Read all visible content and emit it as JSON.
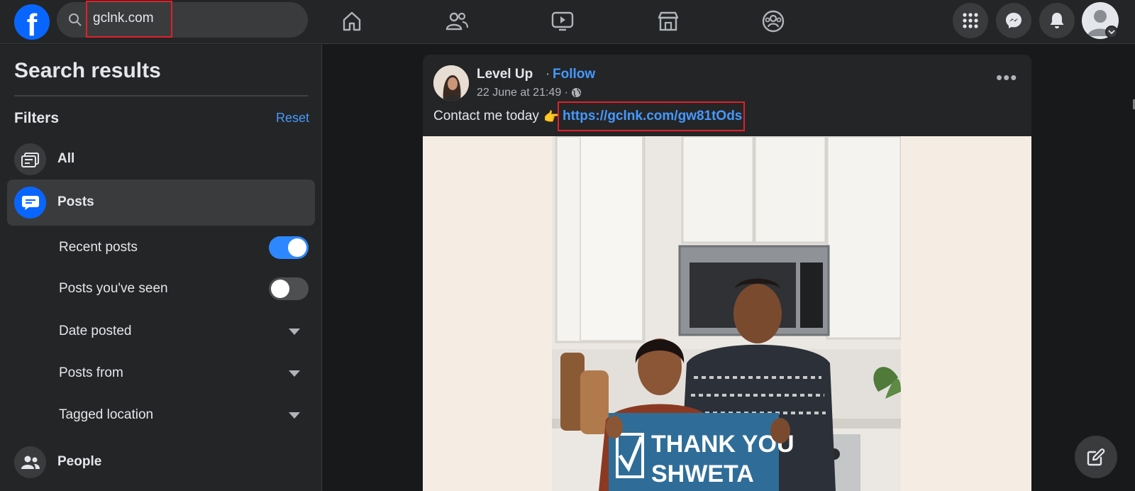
{
  "search": {
    "value": "gclnk.com"
  },
  "top_nav": {
    "items": [
      "home-icon",
      "friends-icon",
      "watch-icon",
      "marketplace-icon",
      "groups-icon"
    ]
  },
  "right_actions": [
    "menu-grid-icon",
    "messenger-icon",
    "notifications-icon",
    "account-avatar"
  ],
  "sidebar": {
    "title": "Search results",
    "filters_label": "Filters",
    "reset_label": "Reset",
    "items": [
      {
        "label": "All",
        "icon": "all-results-icon"
      },
      {
        "label": "Posts",
        "icon": "posts-icon",
        "active": true
      },
      {
        "label": "People",
        "icon": "people-icon"
      }
    ],
    "posts_filters": [
      {
        "label": "Recent posts",
        "type": "toggle",
        "on": true
      },
      {
        "label": "Posts you've seen",
        "type": "toggle",
        "on": false
      },
      {
        "label": "Date posted",
        "type": "dropdown"
      },
      {
        "label": "Posts from",
        "type": "dropdown"
      },
      {
        "label": "Tagged location",
        "type": "dropdown"
      }
    ]
  },
  "post": {
    "author": "Level Up",
    "separator": "·",
    "follow_label": "Follow",
    "timestamp": "22 June at 21:49 ·",
    "text": "Contact me today",
    "emoji": "👉",
    "link": "https://gclnk.com/gw81tOds",
    "photo_sign_text": [
      "THANK YOU",
      "SHWETA"
    ]
  },
  "colors": {
    "brand": "#0866ff",
    "link": "#4599ff",
    "highlight_box": "#e0202a",
    "background": "#18191a",
    "surface": "#242526"
  }
}
